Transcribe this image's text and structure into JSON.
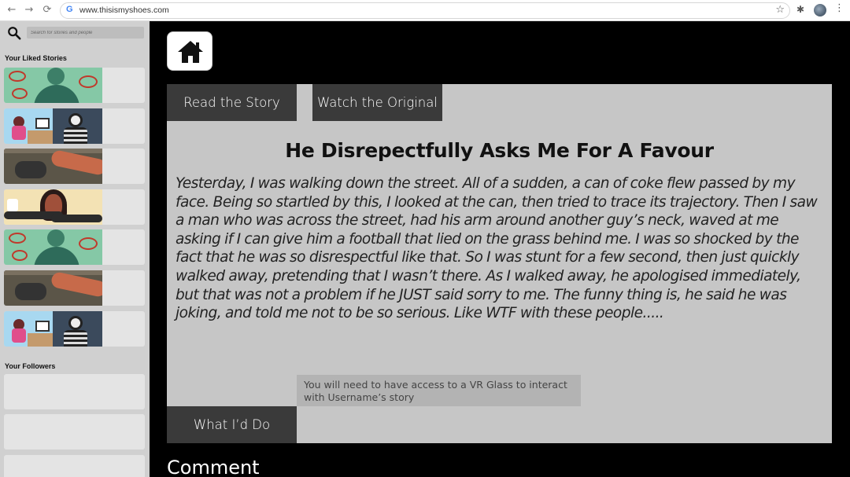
{
  "browser": {
    "url": "www.thisismyshoes.com",
    "nav": {
      "back": "←",
      "forward": "→",
      "reload": "⟳"
    },
    "icons": [
      "google-icon",
      "star-icon",
      "extensions-icon",
      "profile-avatar",
      "menu-dots-icon"
    ]
  },
  "sidebar": {
    "search": {
      "placeholder": "Search for stories and people"
    },
    "liked_title": "Your Liked Stories",
    "liked_stories": [
      {
        "thumbnail": "green-woman"
      },
      {
        "thumbnail": "girl-and-hacker"
      },
      {
        "thumbnail": "dark-arm"
      },
      {
        "thumbnail": "covered-face"
      },
      {
        "thumbnail": "green-woman"
      },
      {
        "thumbnail": "dark-arm"
      },
      {
        "thumbnail": "girl-and-hacker"
      }
    ],
    "followers_title": "Your Followers",
    "followers_count_visible": 3
  },
  "main": {
    "tabs": {
      "read": "Read the Story",
      "watch": "Watch the Original",
      "what_id_do": "What I’d Do"
    },
    "story": {
      "title": "He Disrepectfully Asks Me For A Favour",
      "body": "Yesterday, I was walking down the street. All of a sudden, a can of coke flew passed by my face. Being so startled by this, I looked at the can, then tried to trace its trajectory. Then I saw a man who was across the street, had his arm around another guy’s neck, waved at me asking if I can give him a football that lied on the grass behind me. I was so shocked by the fact that he was so disrespectful like that. So I was stunt for a few second, then just quickly walked away, pretending that I wasn’t there. As I walked away, he apologised immediately, but that was not a problem if he JUST said sorry to me. The funny thing is, he said he was joking, and told me not to be so serious. Like WTF with these people....."
    },
    "vr_notice": "You will need to have access to a VR Glass to interact with Username’s story",
    "comment_heading": "Comment"
  },
  "colors": {
    "page_bg": "#000000",
    "sidebar_bg": "#d0d0d0",
    "panel_bg": "#c6c6c6",
    "tab_bg": "#3a3a3a"
  }
}
